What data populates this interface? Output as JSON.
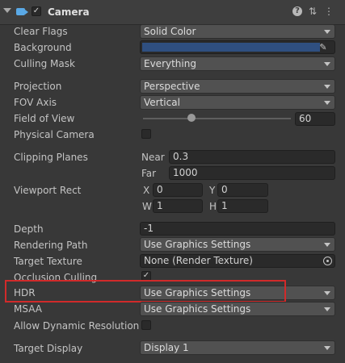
{
  "header": {
    "title": "Camera",
    "enabled": true,
    "icons": [
      "foldout-arrow-icon",
      "camera-icon",
      "help-icon",
      "presets-icon",
      "more-icon"
    ]
  },
  "rows": {
    "clear_flags": {
      "label": "Clear Flags",
      "value": "Solid Color"
    },
    "background": {
      "label": "Background",
      "color": "#2f4f80"
    },
    "culling_mask": {
      "label": "Culling Mask",
      "value": "Everything"
    },
    "projection": {
      "label": "Projection",
      "value": "Perspective"
    },
    "fov_axis": {
      "label": "FOV Axis",
      "value": "Vertical"
    },
    "field_of_view": {
      "label": "Field of View",
      "value": "60",
      "slider_fraction": 0.33
    },
    "physical_camera": {
      "label": "Physical Camera",
      "checked": false
    },
    "clipping_planes": {
      "label": "Clipping Planes",
      "near_label": "Near",
      "near": "0.3",
      "far_label": "Far",
      "far": "1000"
    },
    "viewport_rect": {
      "label": "Viewport Rect",
      "x_label": "X",
      "x": "0",
      "y_label": "Y",
      "y": "0",
      "w_label": "W",
      "w": "1",
      "h_label": "H",
      "h": "1"
    },
    "depth": {
      "label": "Depth",
      "value": "-1"
    },
    "rendering_path": {
      "label": "Rendering Path",
      "value": "Use Graphics Settings"
    },
    "target_texture": {
      "label": "Target Texture",
      "value": "None (Render Texture)"
    },
    "occlusion_culling": {
      "label": "Occlusion Culling",
      "checked": true
    },
    "hdr": {
      "label": "HDR",
      "value": "Use Graphics Settings"
    },
    "msaa": {
      "label": "MSAA",
      "value": "Use Graphics Settings"
    },
    "allow_dynamic_resolution": {
      "label": "Allow Dynamic Resolution",
      "checked": false
    },
    "target_display": {
      "label": "Target Display",
      "value": "Display 1"
    }
  },
  "colors": {
    "highlight": "#d12a2a",
    "accent": "#5aa9e6"
  }
}
